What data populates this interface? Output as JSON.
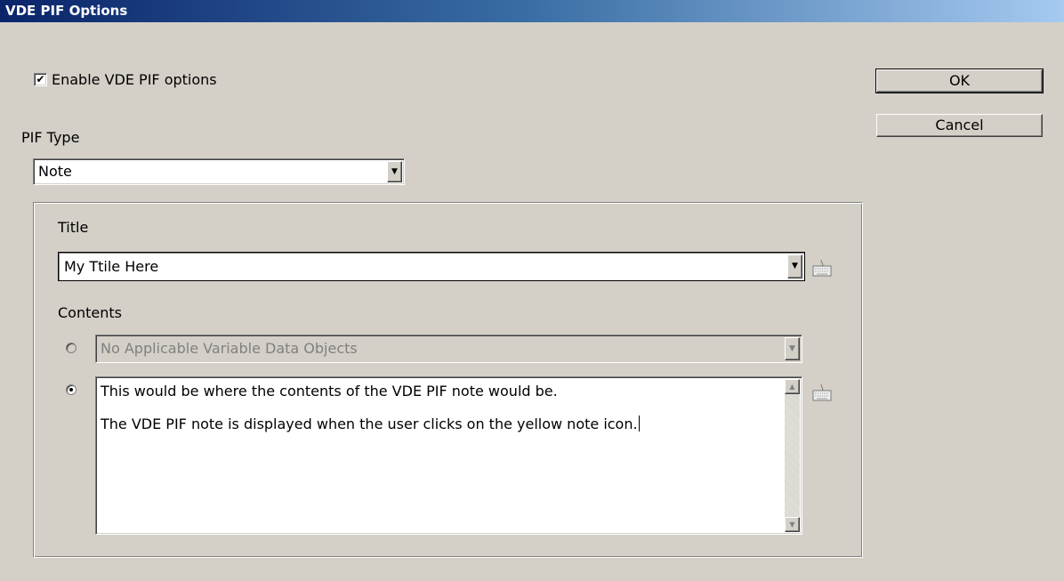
{
  "window": {
    "title": "VDE PIF Options"
  },
  "enable_checkbox": {
    "label": "Enable VDE PIF options",
    "checked": true,
    "check_glyph": "✔"
  },
  "pif_type": {
    "label": "PIF Type",
    "value": "Note"
  },
  "title_section": {
    "label": "Title",
    "value": "My Ttile Here"
  },
  "contents": {
    "label": "Contents",
    "vdo_option": {
      "value": "No Applicable Variable Data Objects",
      "selected": false,
      "enabled": false
    },
    "text_option": {
      "selected": true,
      "lines": [
        "This would be where the contents of the VDE PIF note would be.",
        "The VDE PIF note is displayed when the user clicks on the yellow note icon."
      ]
    }
  },
  "buttons": {
    "ok": "OK",
    "cancel": "Cancel"
  },
  "icons": {
    "dropdown": "chevron-down-icon",
    "keyboard": "keyboard-icon",
    "scroll_up": "arrow-up-icon",
    "scroll_down": "arrow-down-icon"
  },
  "colors": {
    "dialog_bg": "#d4d0c8",
    "titlebar_start": "#0a246a",
    "titlebar_end": "#a6caf0"
  }
}
